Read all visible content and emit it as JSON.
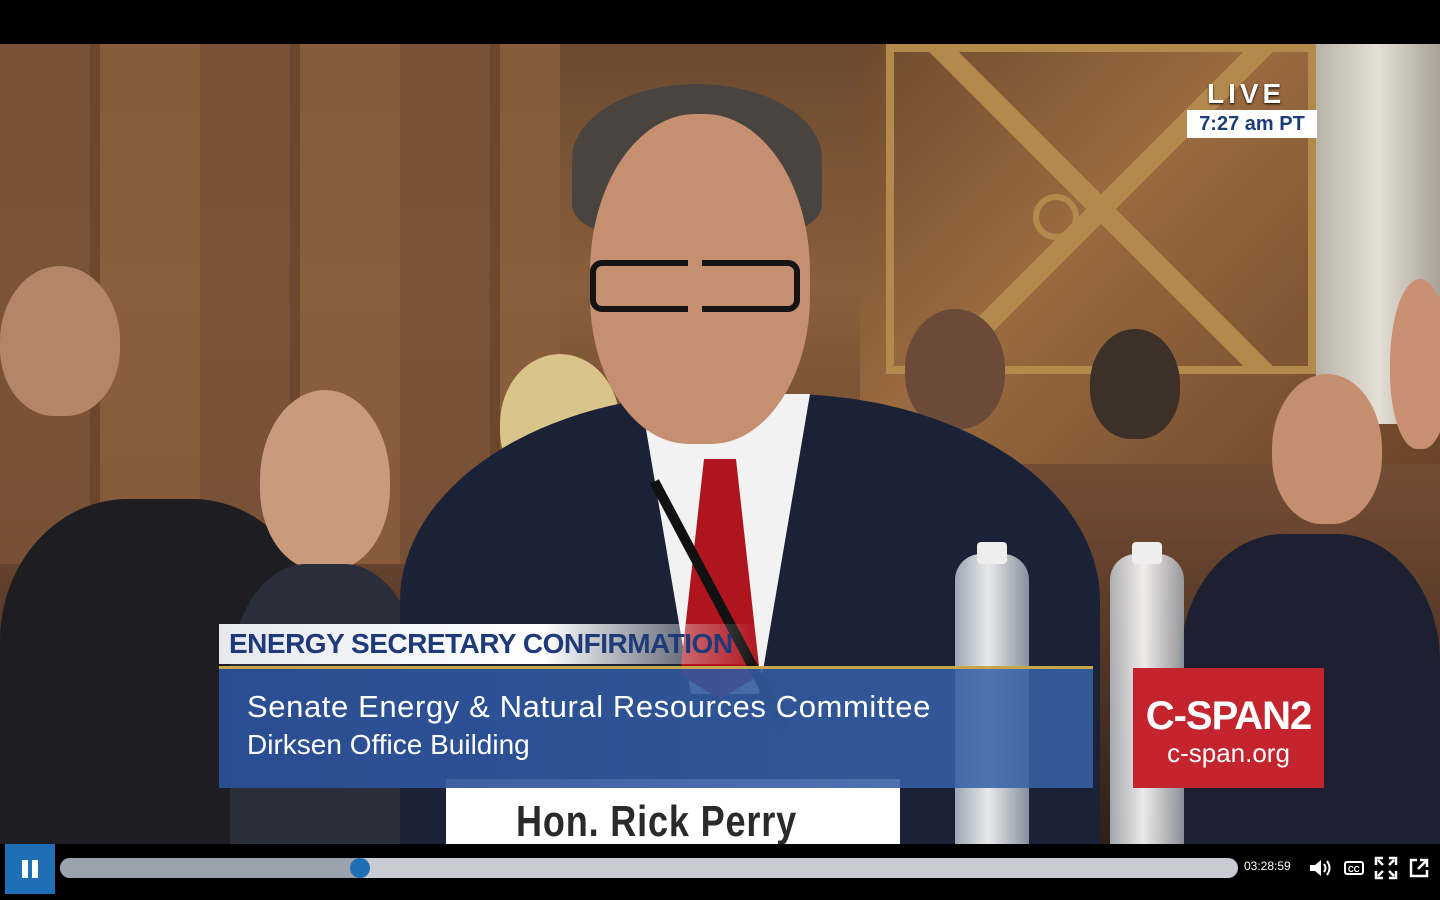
{
  "broadcast": {
    "live_label": "LIVE",
    "live_time": "7:27 am PT",
    "chyron_title": "ENERGY SECRETARY CONFIRMATION",
    "chyron_line1": "Senate Energy & Natural Resources Committee",
    "chyron_line2": "Dirksen Office Building",
    "network_name": "C-SPAN2",
    "network_url": "c-span.org",
    "name_card": "Hon. Rick Perry"
  },
  "player": {
    "state": "playing",
    "elapsed": "03:28:59",
    "progress": 0.255,
    "icons": [
      "pause-icon",
      "volume-icon",
      "closed-captions-icon",
      "fullscreen-icon",
      "popout-icon"
    ]
  },
  "colors": {
    "accent": "#1f6fb7",
    "network_red": "#c4242e",
    "chyron_blue": "#2a4f96"
  }
}
